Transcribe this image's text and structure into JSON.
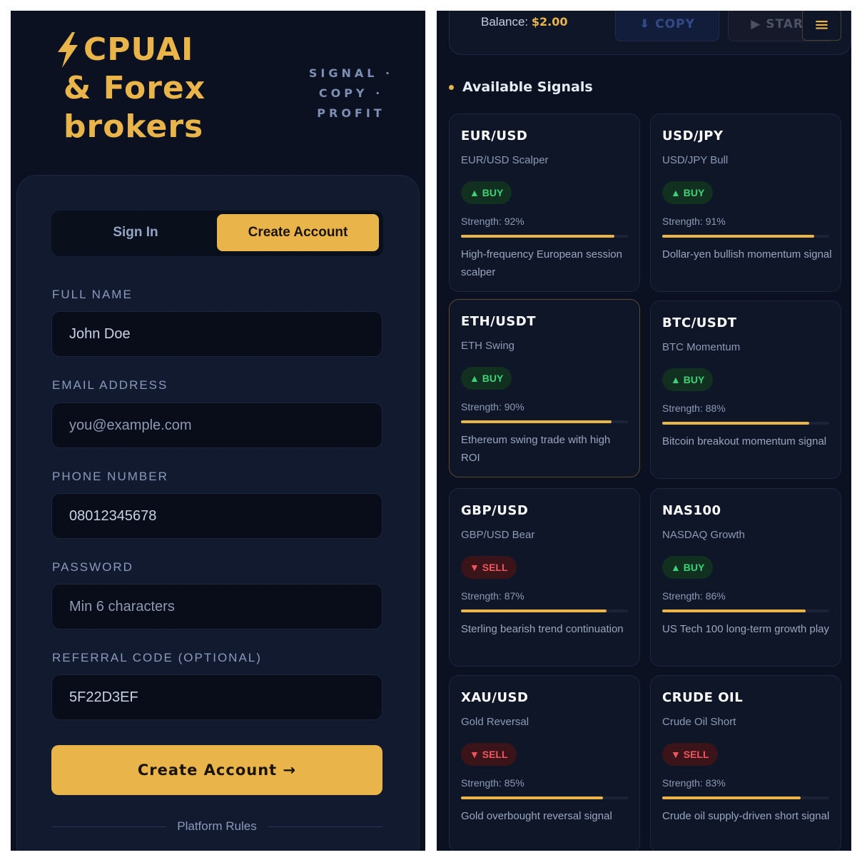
{
  "left": {
    "brand": {
      "line1": "CPUAI",
      "line2": "& Forex",
      "line3": "brokers",
      "tagline": [
        "SIGNAL ·",
        "COPY ·",
        "PROFIT"
      ]
    },
    "tabs": {
      "signin": "Sign In",
      "create": "Create Account"
    },
    "fields": [
      {
        "label": "FULL NAME",
        "value": "John Doe",
        "is_placeholder": false
      },
      {
        "label": "EMAIL ADDRESS",
        "value": "you@example.com",
        "is_placeholder": true
      },
      {
        "label": "PHONE NUMBER",
        "value": "08012345678",
        "is_placeholder": false
      },
      {
        "label": "PASSWORD",
        "value": "Min 6 characters",
        "is_placeholder": true
      },
      {
        "label": "REFERRAL CODE (OPTIONAL)",
        "value": "5F22D3EF",
        "is_placeholder": false
      }
    ],
    "submit": "Create Account →",
    "rules": "Platform Rules"
  },
  "right": {
    "balance_label": "Balance:",
    "balance_value": "$2.00",
    "copy_btn": "⬇ COPY",
    "start_btn": "▶ START",
    "menu_icon": "≡",
    "section_title": "Available Signals",
    "signals": [
      {
        "pair": "EUR/USD",
        "name": "EUR/USD Scalper",
        "side": "▲ BUY",
        "type": "buy",
        "strength_label": "Strength: 92%",
        "strength": 92,
        "desc": "High-frequency European session scalper"
      },
      {
        "pair": "USD/JPY",
        "name": "USD/JPY Bull",
        "side": "▲ BUY",
        "type": "buy",
        "strength_label": "Strength: 91%",
        "strength": 91,
        "desc": "Dollar-yen bullish momentum signal"
      },
      {
        "pair": "ETH/USDT",
        "name": "ETH Swing",
        "side": "▲ BUY",
        "type": "buy",
        "strength_label": "Strength: 90%",
        "strength": 90,
        "desc": "Ethereum swing trade with high ROI"
      },
      {
        "pair": "BTC/USDT",
        "name": "BTC Momentum",
        "side": "▲ BUY",
        "type": "buy",
        "strength_label": "Strength: 88%",
        "strength": 88,
        "desc": "Bitcoin breakout momentum signal"
      },
      {
        "pair": "GBP/USD",
        "name": "GBP/USD Bear",
        "side": "▼ SELL",
        "type": "sell",
        "strength_label": "Strength: 87%",
        "strength": 87,
        "desc": "Sterling bearish trend continuation"
      },
      {
        "pair": "NAS100",
        "name": "NASDAQ Growth",
        "side": "▲ BUY",
        "type": "buy",
        "strength_label": "Strength: 86%",
        "strength": 86,
        "desc": "US Tech 100 long-term growth play"
      },
      {
        "pair": "XAU/USD",
        "name": "Gold Reversal",
        "side": "▼ SELL",
        "type": "sell",
        "strength_label": "Strength: 85%",
        "strength": 85,
        "desc": "Gold overbought reversal signal"
      },
      {
        "pair": "CRUDE OIL",
        "name": "Crude Oil Short",
        "side": "▼ SELL",
        "type": "sell",
        "strength_label": "Strength: 83%",
        "strength": 83,
        "desc": "Crude oil supply-driven short signal"
      }
    ]
  },
  "colors": {
    "accent": "#e9b54a",
    "bg": "#0b1120",
    "buy": "#3bd27a",
    "sell": "#f0565f"
  }
}
